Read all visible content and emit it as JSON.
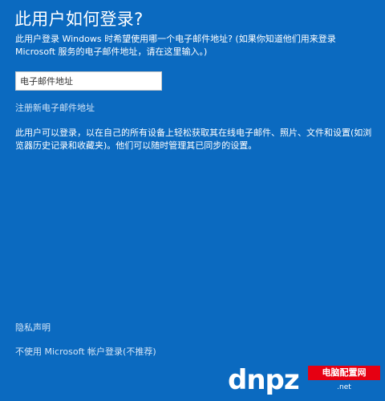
{
  "dialog": {
    "title": "此用户如何登录?",
    "intro": "此用户登录 Windows 时希望使用哪一个电子邮件地址? (如果你知道他们用来登录 Microsoft 服务的电子邮件地址，请在这里输入。)",
    "email_placeholder": "电子邮件地址",
    "email_value": "",
    "register_link": "注册新电子邮件地址",
    "description": "此用户可以登录，以在自己的所有设备上轻松获取其在线电子邮件、照片、文件和设置(如浏览器历史记录和收藏夹)。他们可以随时管理其已同步的设置。",
    "privacy_link": "隐私声明",
    "skip_link": "不使用 Microsoft 帐户登录(不推荐)"
  },
  "watermark": {
    "letters": "dnpz",
    "badge": "电脑配置网",
    "url": ".net"
  },
  "colors": {
    "background": "#0b6ac0",
    "text": "#ffffff",
    "link": "#d6e6f7",
    "badge": "#e60012"
  }
}
